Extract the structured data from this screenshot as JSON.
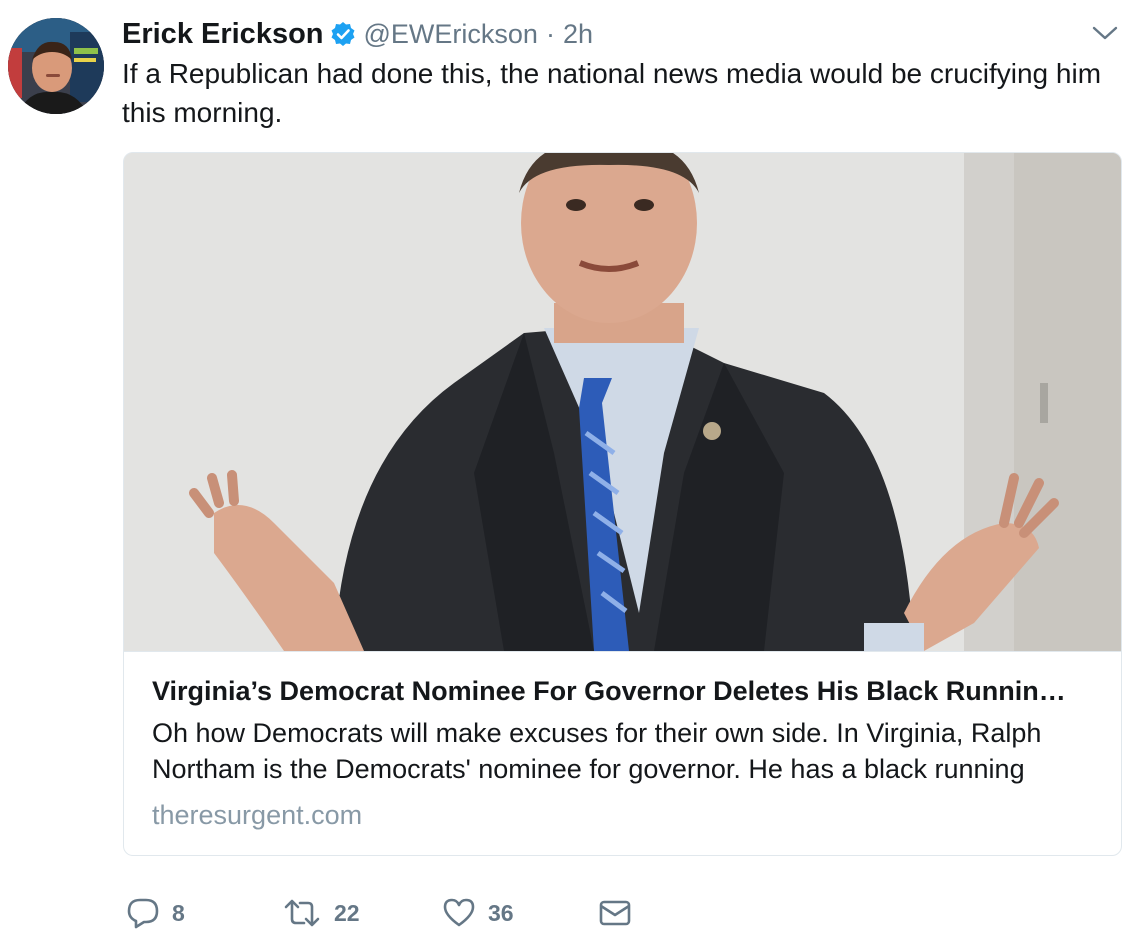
{
  "tweet": {
    "author_name": "Erick Erickson",
    "handle": "@EWErickson",
    "separator": "·",
    "time": "2h",
    "text": "If a Republican had done this, the national news media would be crucifying him this morning.",
    "verified": true,
    "avatar_icon": "avatar-photo"
  },
  "card": {
    "title": "Virginia’s Democrat Nominee For Governor Deletes His Black Runnin…",
    "description": "Oh how Democrats will make excuses for their own side. In Virginia, Ralph Northam is the Democrats' nominee for governor. He has a black running",
    "domain": "theresurgent.com"
  },
  "actions": {
    "reply_count": "8",
    "retweet_count": "22",
    "like_count": "36"
  },
  "colors": {
    "verified_blue": "#1da1f2",
    "secondary_text": "#657786",
    "domain_text": "#8899a6",
    "border": "#e1e8ed"
  }
}
